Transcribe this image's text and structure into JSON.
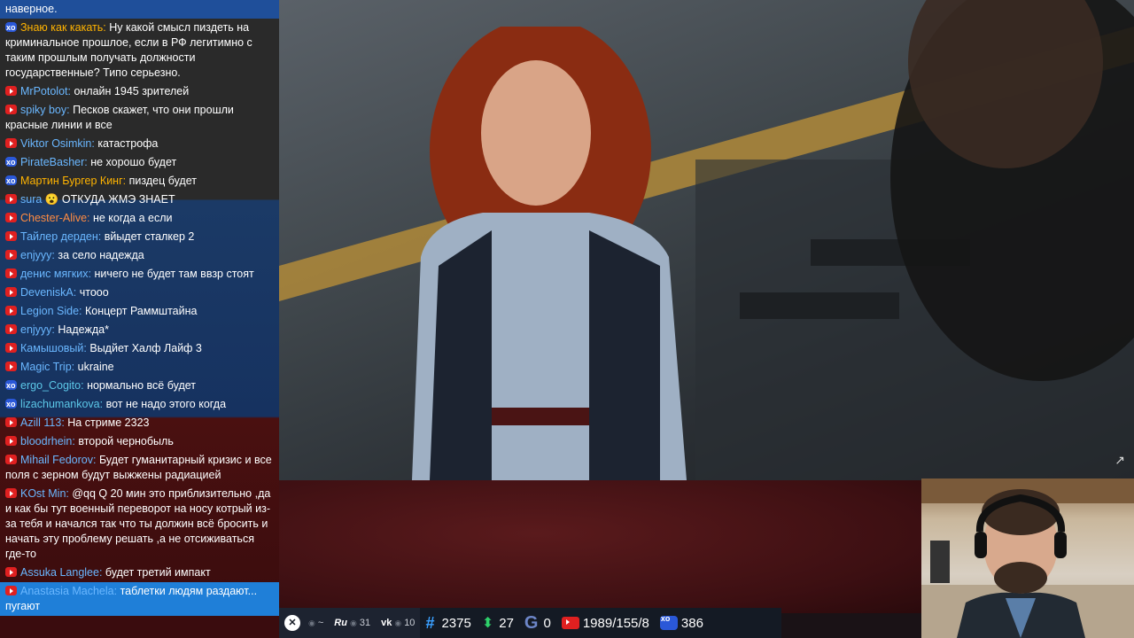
{
  "chat": {
    "messages": [
      {
        "platform": "none",
        "nick": "",
        "nick_color": "#ffffff",
        "text": "наверное."
      },
      {
        "platform": "vk",
        "nick": "Знаю как какать:",
        "nick_color": "#ffb300",
        "text": "Ну какой смысл пиздеть на криминальное прошлое, если в РФ легитимно с таким прошлым получать должности государственные? Типо серьезно."
      },
      {
        "platform": "yt",
        "nick": "MrPotolot:",
        "nick_color": "#6ab7ff",
        "text": "онлайн 1945 зрителей"
      },
      {
        "platform": "yt",
        "nick": "spiky boy:",
        "nick_color": "#6ab7ff",
        "text": "Песков скажет, что они прошли красные линии и все"
      },
      {
        "platform": "yt",
        "nick": "Viktor Osimkin:",
        "nick_color": "#6ab7ff",
        "text": "катастрофа"
      },
      {
        "platform": "vk",
        "nick": "PirateBasher:",
        "nick_color": "#6ab7ff",
        "text": "не хорошо будет"
      },
      {
        "platform": "vk",
        "nick": "Мартин Бургер Кинг:",
        "nick_color": "#ffb300",
        "text": "пиздец будет"
      },
      {
        "platform": "yt",
        "nick": "sura",
        "nick_color": "#6ab7ff",
        "text": "ОТКУДА ЖМЭ ЗНАЕТ",
        "emoji": "😮"
      },
      {
        "platform": "yt",
        "nick": "Chester-Alive:",
        "nick_color": "#ff8c42",
        "text": "не когда а если"
      },
      {
        "platform": "yt",
        "nick": "Тайлер дерден:",
        "nick_color": "#6ab7ff",
        "text": "вйыдет сталкер 2"
      },
      {
        "platform": "yt",
        "nick": "enjyyy:",
        "nick_color": "#6ab7ff",
        "text": "за село надежда"
      },
      {
        "platform": "yt",
        "nick": "денис мягких:",
        "nick_color": "#6ab7ff",
        "text": "ничего не будет там ввзр стоят"
      },
      {
        "platform": "yt",
        "nick": "DeveniskA:",
        "nick_color": "#6ab7ff",
        "text": "чтооо"
      },
      {
        "platform": "yt",
        "nick": "Legion Side:",
        "nick_color": "#6ab7ff",
        "text": "Концерт Раммштайна"
      },
      {
        "platform": "yt",
        "nick": "enjyyy:",
        "nick_color": "#6ab7ff",
        "text": "Надежда*"
      },
      {
        "platform": "yt",
        "nick": "Камышовый:",
        "nick_color": "#6ab7ff",
        "text": "Выдйет Халф Лайф 3"
      },
      {
        "platform": "yt",
        "nick": "Magic Trip:",
        "nick_color": "#6ab7ff",
        "text": "ukraine"
      },
      {
        "platform": "vk",
        "nick": "ergo_Cogito:",
        "nick_color": "#5cc8e8",
        "text": "нормально всё будет"
      },
      {
        "platform": "vk",
        "nick": "lizachumankova:",
        "nick_color": "#5cc8e8",
        "text": "вот не надо этого когда"
      },
      {
        "platform": "yt",
        "nick": "Azill 113:",
        "nick_color": "#6ab7ff",
        "text": "На стриме 2323"
      },
      {
        "platform": "yt",
        "nick": "bloodrhein:",
        "nick_color": "#6ab7ff",
        "text": "второй чернобыль"
      },
      {
        "platform": "yt",
        "nick": "Mihail Fedorov:",
        "nick_color": "#6ab7ff",
        "text": "Будет гуманитарный кризис и все поля с зерном будут выжжены радиацией"
      },
      {
        "platform": "yt",
        "nick": "KOst Min:",
        "nick_color": "#6ab7ff",
        "text": "@qq Q 20 мин это приблизительно ,да и как бы тут военный переворот на носу котрый из-за тебя и начался так что ты должин всё бросить и начать эту проблему решать ,а не отсиживаться где-то"
      },
      {
        "platform": "yt",
        "nick": "Assuka Langlee:",
        "nick_color": "#6ab7ff",
        "text": "будет третий импакт"
      },
      {
        "platform": "yt",
        "nick": "Anastasia Machela:",
        "nick_color": "#6ab7ff",
        "text": "таблетки людям раздают... пугают"
      }
    ]
  },
  "stats": {
    "twitch_dot": "●",
    "ru_label": "Ru",
    "ru_count": "31",
    "vk_label": "vk",
    "vk_count": "10",
    "hash_count": "2375",
    "up_count": "27",
    "g_count": "0",
    "yt_counts": "1989/155/8",
    "vkplay_count": "386"
  },
  "colors": {
    "yt": "#e02020",
    "vk": "#2a58d8",
    "accent": "#1f7fd8"
  }
}
